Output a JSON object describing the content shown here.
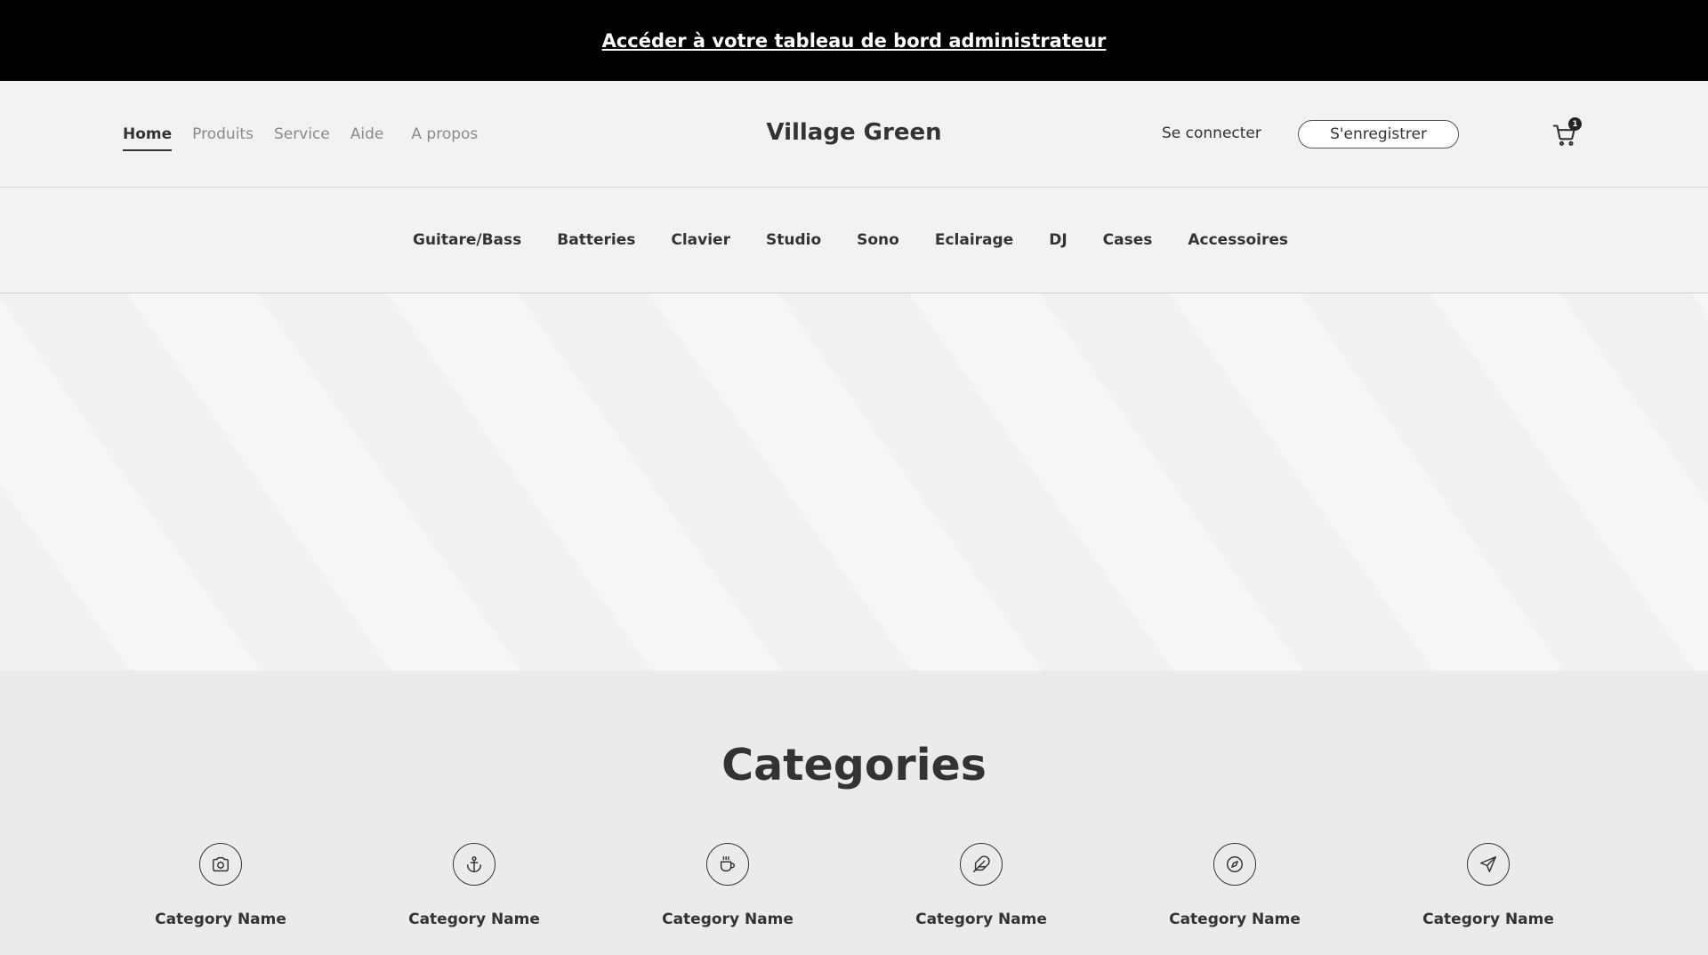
{
  "admin_bar": {
    "link": "Accéder à votre tableau de bord administrateur"
  },
  "header": {
    "nav": [
      "Home",
      "Produits",
      "Service",
      "Aide",
      "A propos"
    ],
    "brand": "Village Green",
    "login": "Se connecter",
    "register": "S'enregistrer",
    "cart_count": "1",
    "cart_icon": "cart-icon"
  },
  "category_nav": [
    "Guitare/Bass",
    "Batteries",
    "Clavier",
    "Studio",
    "Sono",
    "Eclairage",
    "DJ",
    "Cases",
    "Accessoires"
  ],
  "categories": {
    "title": "Categories",
    "items": [
      {
        "name": "Category Name",
        "icon": "camera-icon"
      },
      {
        "name": "Category Name",
        "icon": "anchor-icon"
      },
      {
        "name": "Category Name",
        "icon": "coffee-icon"
      },
      {
        "name": "Category Name",
        "icon": "feather-icon"
      },
      {
        "name": "Category Name",
        "icon": "compass-icon"
      },
      {
        "name": "Category Name",
        "icon": "send-icon"
      }
    ]
  },
  "colors": {
    "admin_bar_bg": "#000000",
    "header_bg": "#f2f2f2",
    "text": "#333333",
    "section_bg": "#ebebeb"
  }
}
